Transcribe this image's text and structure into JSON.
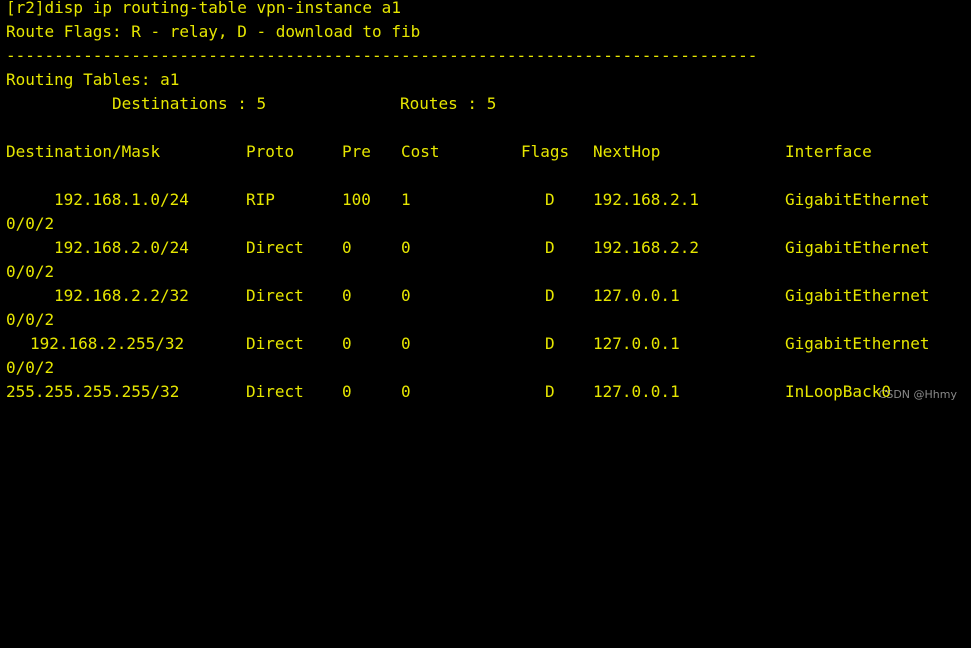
{
  "terminal": {
    "command": "[r2]disp ip routing-table vpn-instance a1",
    "flags_legend": "Route Flags: R - relay, D - download to fib",
    "separator": "------------------------------------------------------------------------------",
    "tables_label": "Routing Tables: a1",
    "destinations_label": "Destinations : 5",
    "routes_label": "Routes : 5",
    "headers": {
      "destination": "Destination/Mask",
      "proto": "Proto",
      "pre": "Pre",
      "cost": "Cost",
      "flags": "Flags",
      "nexthop": "NextHop",
      "interface": "Interface"
    },
    "rows": [
      {
        "destination": "192.168.1.0/24",
        "proto": "RIP",
        "pre": "100",
        "cost": "1",
        "flags": "D",
        "nexthop": "192.168.2.1",
        "interface": "GigabitEthernet",
        "interface_cont": "0/0/2"
      },
      {
        "destination": "192.168.2.0/24",
        "proto": "Direct",
        "pre": "0",
        "cost": "0",
        "flags": "D",
        "nexthop": "192.168.2.2",
        "interface": "GigabitEthernet",
        "interface_cont": "0/0/2"
      },
      {
        "destination": "192.168.2.2/32",
        "proto": "Direct",
        "pre": "0",
        "cost": "0",
        "flags": "D",
        "nexthop": "127.0.0.1",
        "interface": "GigabitEthernet",
        "interface_cont": "0/0/2"
      },
      {
        "destination": "192.168.2.255/32",
        "proto": "Direct",
        "pre": "0",
        "cost": "0",
        "flags": "D",
        "nexthop": "127.0.0.1",
        "interface": "GigabitEthernet",
        "interface_cont": "0/0/2"
      },
      {
        "destination": "255.255.255.255/32",
        "proto": "Direct",
        "pre": "0",
        "cost": "0",
        "flags": "D",
        "nexthop": "127.0.0.1",
        "interface": "InLoopBack0",
        "interface_cont": ""
      }
    ]
  },
  "watermark": "CSDN @Hhmy",
  "colors": {
    "background": "#000000",
    "text": "#e6e600"
  }
}
